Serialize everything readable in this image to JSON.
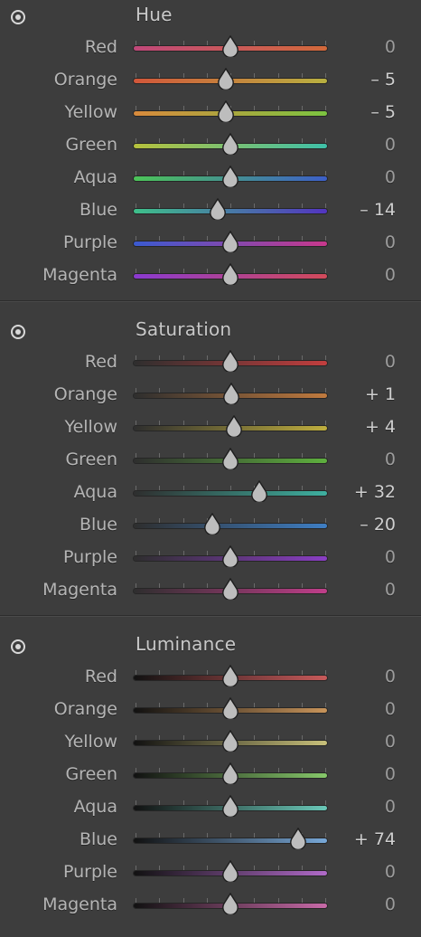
{
  "sections": [
    {
      "id": "hue",
      "title": "Hue",
      "rows": [
        {
          "label": "Red",
          "value": "0",
          "amount": 0,
          "track": [
            "#c0487a",
            "#d2693a"
          ]
        },
        {
          "label": "Orange",
          "value": "– 5",
          "amount": -5,
          "track": [
            "#d2563a",
            "#b8b040"
          ]
        },
        {
          "label": "Yellow",
          "value": "– 5",
          "amount": -5,
          "track": [
            "#d98a3c",
            "#7cc440"
          ]
        },
        {
          "label": "Green",
          "value": "0",
          "amount": 0,
          "track": [
            "#b6c13c",
            "#3ec0a8"
          ]
        },
        {
          "label": "Aqua",
          "value": "0",
          "amount": 0,
          "track": [
            "#4cc458",
            "#3d5fc8"
          ]
        },
        {
          "label": "Blue",
          "value": "– 14",
          "amount": -14,
          "track": [
            "#3ec08a",
            "#5234c0"
          ]
        },
        {
          "label": "Purple",
          "value": "0",
          "amount": 0,
          "track": [
            "#3a5ad0",
            "#c8388c"
          ]
        },
        {
          "label": "Magenta",
          "value": "0",
          "amount": 0,
          "track": [
            "#8a3ad0",
            "#d24a5a"
          ]
        }
      ]
    },
    {
      "id": "saturation",
      "title": "Saturation",
      "rows": [
        {
          "label": "Red",
          "value": "0",
          "amount": 0,
          "track": [
            "#2e2e2e",
            "#c23e3e"
          ]
        },
        {
          "label": "Orange",
          "value": "+ 1",
          "amount": 1,
          "track": [
            "#2e2e2e",
            "#c07a3e"
          ]
        },
        {
          "label": "Yellow",
          "value": "+ 4",
          "amount": 4,
          "track": [
            "#2e2e2e",
            "#bfae3e"
          ]
        },
        {
          "label": "Green",
          "value": "0",
          "amount": 0,
          "track": [
            "#2e2e2e",
            "#5eb03e"
          ]
        },
        {
          "label": "Aqua",
          "value": "+ 32",
          "amount": 32,
          "track": [
            "#2e2e2e",
            "#3eb0a0"
          ]
        },
        {
          "label": "Blue",
          "value": "– 20",
          "amount": -20,
          "track": [
            "#2e2e2e",
            "#3e7ec4"
          ]
        },
        {
          "label": "Purple",
          "value": "0",
          "amount": 0,
          "track": [
            "#2e2e2e",
            "#8a3ec4"
          ]
        },
        {
          "label": "Magenta",
          "value": "0",
          "amount": 0,
          "track": [
            "#2e2e2e",
            "#c03e8a"
          ]
        }
      ]
    },
    {
      "id": "luminance",
      "title": "Luminance",
      "rows": [
        {
          "label": "Red",
          "value": "0",
          "amount": 0,
          "track": [
            "#111111",
            "#c85a5a"
          ]
        },
        {
          "label": "Orange",
          "value": "0",
          "amount": 0,
          "track": [
            "#111111",
            "#c8945a"
          ]
        },
        {
          "label": "Yellow",
          "value": "0",
          "amount": 0,
          "track": [
            "#111111",
            "#c8c07a"
          ]
        },
        {
          "label": "Green",
          "value": "0",
          "amount": 0,
          "track": [
            "#111111",
            "#86c86a"
          ]
        },
        {
          "label": "Aqua",
          "value": "0",
          "amount": 0,
          "track": [
            "#111111",
            "#6ac8b8"
          ]
        },
        {
          "label": "Blue",
          "value": "+ 74",
          "amount": 74,
          "track": [
            "#111111",
            "#78a8d8"
          ]
        },
        {
          "label": "Purple",
          "value": "0",
          "amount": 0,
          "track": [
            "#111111",
            "#b06ac8"
          ]
        },
        {
          "label": "Magenta",
          "value": "0",
          "amount": 0,
          "track": [
            "#111111",
            "#c86aa8"
          ]
        }
      ]
    }
  ],
  "icons": {
    "target_adjust": "target-adjustment-icon",
    "thumb": "slider-thumb-icon"
  }
}
